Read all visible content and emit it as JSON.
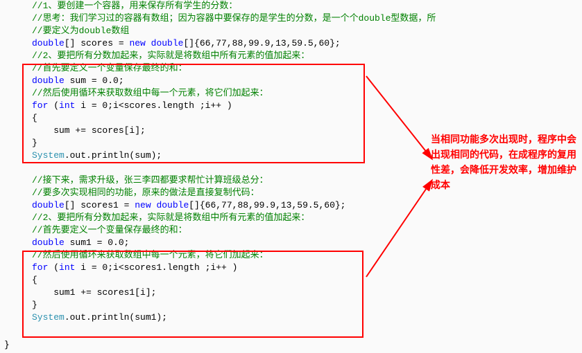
{
  "code": {
    "line1": "//1、要创建一个容器，用来保存所有学生的分数：",
    "line2": "//思考：我们学习过的容器有数组；因为容器中要保存的是学生的分数，是一个个double型数据，所",
    "line3": "//要定义为double数组",
    "line4_p1": "double",
    "line4_p2": "[] scores = ",
    "line4_p3": "new",
    "line4_p4": " double",
    "line4_p5": "[]{66,77,88,99.9,13,59.5,60};",
    "line5": "//2、要把所有分数加起来，实际就是将数组中所有元素的值加起来：",
    "line6": "//首先要定义一个变量保存最终的和：",
    "line7_p1": "double",
    "line7_p2": " sum = 0.0;",
    "line8": "//然后使用循环来获取数组中每一个元素，将它们加起来：",
    "line9_p1": "for",
    "line9_p2": " (",
    "line9_p3": "int",
    "line9_p4": " i = 0;i<scores.length ;i++ )",
    "line10": "{",
    "line11": "    sum += scores[i];",
    "line12": "}",
    "line13_p1": "System",
    "line13_p2": ".out.println(sum);",
    "blank": "",
    "line14": "//接下来，需求升级，张三李四都要求帮忙计算班级总分：",
    "line15": "//要多次实现相同的功能，原来的做法是直接复制代码：",
    "line16_p1": "double",
    "line16_p2": "[] scores1 = ",
    "line16_p3": "new",
    "line16_p4": " double",
    "line16_p5": "[]{66,77,88,99.9,13,59.5,60};",
    "line17": "//2、要把所有分数加起来，实际就是将数组中所有元素的值加起来：",
    "line18": "//首先要定义一个变量保存最终的和：",
    "line19_p1": "double",
    "line19_p2": " sum1 = 0.0;",
    "line20": "//然后使用循环来获取数组中每一个元素，将它们加起来：",
    "line21_p1": "for",
    "line21_p2": " (",
    "line21_p3": "int",
    "line21_p4": " i = 0;i<scores1.length ;i++ )",
    "line22": "{",
    "line23": "    sum1 += scores1[i];",
    "line24": "}",
    "line25_p1": "System",
    "line25_p2": ".out.println(sum1);",
    "closing": "}"
  },
  "annotation": {
    "text": "当相同功能多次出现时，程序中会出现相同的代码，在成程序的复用性差，会降低开发效率，增加维护成本"
  }
}
